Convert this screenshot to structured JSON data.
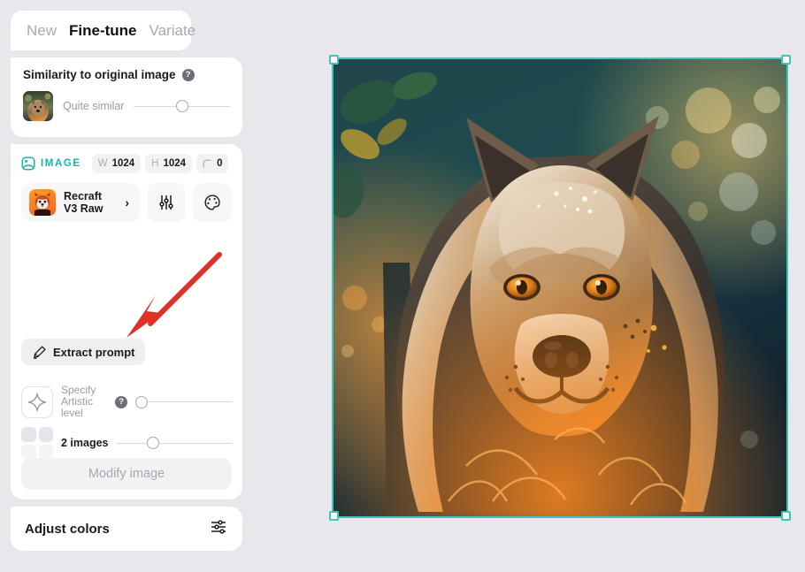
{
  "tabs": [
    {
      "label": "New",
      "active": false
    },
    {
      "label": "Fine-tune",
      "active": true
    },
    {
      "label": "Variate",
      "active": false
    }
  ],
  "similarity": {
    "title": "Similarity to original image",
    "help_icon": "question-mark-icon",
    "thumbnail_alt": "dog-portrait-thumbnail",
    "value_label": "Quite similar",
    "slider_percent": 50
  },
  "image_settings": {
    "kind_icon": "image-icon",
    "kind_label": "IMAGE",
    "width_key": "W",
    "width_value": "1024",
    "height_key": "H",
    "height_value": "1024",
    "corner_icon": "corner-radius-icon",
    "corner_value": "0"
  },
  "model": {
    "icon": "red-panda-icon",
    "name": "Recraft\nV3 Raw",
    "name_line1": "Recraft",
    "name_line2": "V3 Raw",
    "chevron": "›",
    "settings_icon": "vertical-sliders-icon",
    "palette_icon": "color-palette-icon"
  },
  "extract": {
    "icon": "pencil-icon",
    "label": "Extract prompt"
  },
  "artistic": {
    "icon": "four-point-star-icon",
    "label_line1": "Specify",
    "label_line2": "Artistic",
    "label_line3": "level",
    "help_icon": "question-mark-icon",
    "slider_percent": 0
  },
  "images_count": {
    "icon": "grid-2x2-icon",
    "label": "2 images",
    "slider_percent": 30
  },
  "modify": {
    "label": "Modify image",
    "enabled": false
  },
  "adjust_colors": {
    "label": "Adjust colors",
    "icon": "horizontal-sliders-icon"
  },
  "canvas": {
    "selection_color": "#3cc5bb",
    "artwork_alt": "fluffy-dog-portrait-with-bokeh-background",
    "handles": [
      "top-left",
      "top-right",
      "bottom-left",
      "bottom-right"
    ]
  },
  "annotation": {
    "arrow_color": "#e03127",
    "points_to": "extract-prompt-button"
  },
  "theme": {
    "background": "#e8e8ec",
    "accent": "#17b6a6",
    "panel": "#ffffff"
  }
}
